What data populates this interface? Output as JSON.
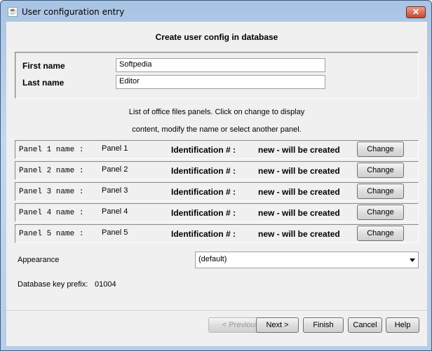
{
  "window": {
    "title": "User configuration entry",
    "close_label": "✕"
  },
  "heading": "Create user config in database",
  "form": {
    "first_name_label": "First name",
    "first_name_value": "Softpedia",
    "last_name_label": "Last name",
    "last_name_value": "Editor"
  },
  "instructions": [
    "List of office files panels. Click on change to display",
    "content, modify the name or select another panel."
  ],
  "panels": [
    {
      "label": "Panel 1 name :",
      "name": "Panel 1",
      "id_label": "Identification # :",
      "id_value": "new - will be created",
      "button": "Change"
    },
    {
      "label": "Panel 2 name :",
      "name": "Panel 2",
      "id_label": "Identification # :",
      "id_value": "new - will be created",
      "button": "Change"
    },
    {
      "label": "Panel 3 name :",
      "name": "Panel 3",
      "id_label": "Identification # :",
      "id_value": "new - will be created",
      "button": "Change"
    },
    {
      "label": "Panel 4 name :",
      "name": "Panel 4",
      "id_label": "Identification # :",
      "id_value": "new - will be created",
      "button": "Change"
    },
    {
      "label": "Panel 5 name :",
      "name": "Panel 5",
      "id_label": "Identification # :",
      "id_value": "new - will be created",
      "button": "Change"
    }
  ],
  "appearance": {
    "label": "Appearance",
    "value": "(default)"
  },
  "db_key": {
    "label": "Database key prefix:",
    "value": "01004"
  },
  "buttons": {
    "previous": "< Previous",
    "next": "Next >",
    "finish": "Finish",
    "cancel": "Cancel",
    "help": "Help"
  }
}
